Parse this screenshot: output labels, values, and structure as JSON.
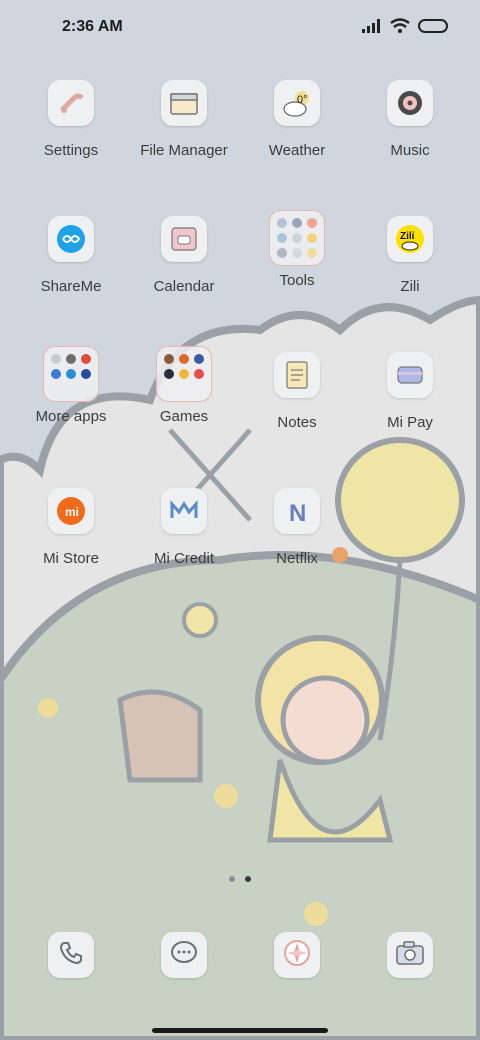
{
  "status_bar": {
    "time": "2:36 AM"
  },
  "apps": [
    {
      "label": "Settings",
      "icon": "settings-icon"
    },
    {
      "label": "File Manager",
      "icon": "file-manager-icon"
    },
    {
      "label": "Weather",
      "icon": "weather-icon",
      "temp": "0°"
    },
    {
      "label": "Music",
      "icon": "music-icon"
    },
    {
      "label": "ShareMe",
      "icon": "shareme-icon"
    },
    {
      "label": "Calendar",
      "icon": "calendar-icon"
    },
    {
      "label": "Tools",
      "icon": "tools-folder-icon"
    },
    {
      "label": "Zili",
      "icon": "zili-icon",
      "badge": "Zili"
    },
    {
      "label": "More apps",
      "icon": "more-apps-folder-icon"
    },
    {
      "label": "Games",
      "icon": "games-folder-icon"
    },
    {
      "label": "Notes",
      "icon": "notes-icon"
    },
    {
      "label": "Mi Pay",
      "icon": "mi-pay-icon"
    },
    {
      "label": "Mi Store",
      "icon": "mi-store-icon",
      "badge": "mi"
    },
    {
      "label": "Mi Credit",
      "icon": "mi-credit-icon"
    },
    {
      "label": "Netflix",
      "icon": "netflix-icon",
      "badge": "N"
    }
  ],
  "page_indicator": {
    "pages": 2,
    "current": 2
  },
  "dock": [
    {
      "icon": "phone-icon"
    },
    {
      "icon": "messages-icon"
    },
    {
      "icon": "browser-icon"
    },
    {
      "icon": "camera-icon"
    }
  ]
}
